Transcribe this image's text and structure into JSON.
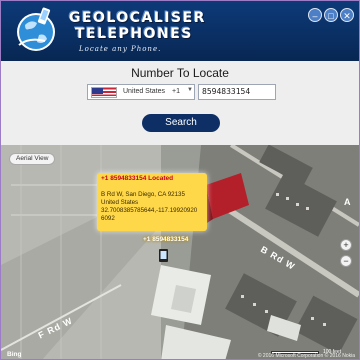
{
  "header": {
    "title_line1": "GEOLOCALISER",
    "title_line2": "TELEPHONES",
    "tagline": "Locate any Phone."
  },
  "window_controls": {
    "minimize_glyph": "–",
    "maximize_glyph": "□",
    "close_glyph": "✕"
  },
  "form": {
    "label": "Number To Locate",
    "country_name": "United States",
    "country_code": "+1",
    "phone_value": "8594833154",
    "search_label": "Search"
  },
  "map": {
    "view_toggle": "Aerial View",
    "popup_title": "+1 8594833154 Located",
    "popup_lines": [
      "B Rd W, San Diego, CA 92135",
      "United States",
      "32.7008385785644,-117.19920920",
      "6092"
    ],
    "pin_label": "+1 8594833154",
    "road_labels": [
      "B Rd W",
      "F Rd W",
      "A"
    ],
    "zoom_in": "+",
    "zoom_out": "−",
    "bing": "Bing",
    "scale_label": "100 feet",
    "copyright": "© 2016 Microsoft Corporation  © 2016 Nokia"
  },
  "colors": {
    "header_bg": "#0a2f63",
    "search_button": "#0e2f66",
    "popup_bg": "#ffd84a",
    "popup_title": "#c8001e",
    "window_border": "#9c7cc4"
  }
}
